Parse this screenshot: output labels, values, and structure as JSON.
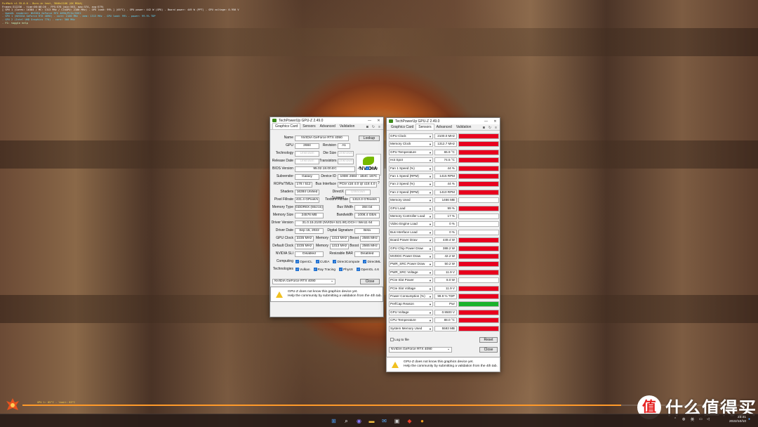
{
  "osd": {
    "line1": "FurMark v1.35.0.0 - Burn-in test, 3840x2160 (0X MSAA)",
    "line2": "Frames:312236 - time:00:08:26 - FPS:578 (min:563, max:574, avg:579)",
    "line3": "[ GPU 1 (Cores: 16384 / MC: 1313 MHz / ClkGPU: 2100 MHz) - GPU load: 99% ] (65°C) - GPU power: 442 W (GPU) - Board power: 449 W (PPT) - GPU voltage: 0.950 V",
    "line4": "- OpenGL renderer: NVIDIA GeForce RTX 4090/PCIe/SSE2",
    "line5": "- GPU 1 (NVIDIA GeForce RTX 4090) - core: 2100 MHz - mem: 1313 MHz - GPU load: 99% - power: 99.9% TDP",
    "line6": "- GPU 2 (Intel UHD Graphics 770) - core: 300 MHz",
    "line7": "- F1: toggle help",
    "bottom": "GPU 1: 65°C - limit: 83°C"
  },
  "benchmark": {
    "progress": 0.82,
    "accent": "#ff9a2a"
  },
  "window1": {
    "title": "TechPowerUp GPU-Z 2.49.0",
    "tabs": [
      "Graphics Card",
      "Sensors",
      "Advanced",
      "Validation"
    ],
    "selected_tab": "Graphics Card",
    "icons": [
      "camera-icon",
      "refresh-icon",
      "menu-icon"
    ],
    "fields": {
      "name_label": "Name",
      "name": "NVIDIA GeForce RTX 4090",
      "lookup": "Lookup",
      "gpu_label": "GPU",
      "gpu": "2684",
      "revision_label": "Revision",
      "revision": "A1",
      "technology_label": "Technology",
      "technology": "Unknown",
      "die_size_label": "Die Size",
      "die_size": "Unknown",
      "release_date_label": "Release Date",
      "release_date": "Unknown",
      "transistors_label": "Transistors",
      "transistors": "Unknown",
      "bios_label": "BIOS Version",
      "bios": "95.02.18.00.EC",
      "uefi": "UEFI",
      "subvendor_label": "Subvendor",
      "subvendor": "Galaxy",
      "device_id_label": "Device ID",
      "device_id": "10DE 2684 - 1B4C 167C",
      "rops_label": "ROPs/TMUs",
      "rops": "176 / 512",
      "bus_interface_label": "Bus Interface",
      "bus_interface": "PCIe x16 4.0 @ x16 4.0",
      "shaders_label": "Shaders",
      "shaders": "16384 Unified",
      "directx_label": "DirectX Support",
      "directx": "Unknown",
      "pixel_label": "Pixel Fillrate",
      "pixel": "431.4 GPixel/s",
      "texture_label": "Texture Fillrate",
      "texture": "1313.3 GTexel/s",
      "memtype_label": "Memory Type",
      "memtype": "GDDR6X (Micron)",
      "buswidth_label": "Bus Width",
      "buswidth": "384 bit",
      "memsize_label": "Memory Size",
      "memsize": "24576 MB",
      "bandwidth_label": "Bandwidth",
      "bandwidth": "1008.4 GB/s",
      "driver_label": "Driver Version",
      "driver": "31.0.15.2100 (NVIDIA 521.90) DCH / Win11 64",
      "driverdate_label": "Driver Date",
      "driverdate": "Sep 15, 2022",
      "digsig_label": "Digital Signature",
      "digsig": "Beta",
      "gpuclock_label": "GPU Clock",
      "gpuclock": "2235 MHz",
      "mem_label": "Memory",
      "memclock": "1313 MHz",
      "boost_label": "Boost",
      "boost": "2565 MHz",
      "defclock_label": "Default Clock",
      "defclock": "2235 MHz",
      "defmem": "1313 MHz",
      "defboost": "2565 MHz",
      "sli_label": "NVIDIA SLI",
      "sli": "Disabled",
      "rebar_label": "Resizable BAR",
      "rebar": "Disabled",
      "computing_label": "Computing",
      "technologies_label": "Technologies"
    },
    "computing": [
      {
        "label": "OpenCL",
        "checked": true
      },
      {
        "label": "CUDA",
        "checked": true
      },
      {
        "label": "DirectCompute",
        "checked": true
      },
      {
        "label": "DirectML",
        "checked": true
      }
    ],
    "technologies": [
      {
        "label": "Vulkan",
        "checked": true
      },
      {
        "label": "Ray Tracing",
        "checked": true
      },
      {
        "label": "PhysX",
        "checked": true
      },
      {
        "label": "OpenGL 4.6",
        "checked": true
      }
    ],
    "device_select": "NVIDIA GeForce RTX 4090",
    "close": "Close",
    "warning_line1": "GPU-Z does not know this graphics device yet.",
    "warning_line2": "Help the community by submitting a validation from the 4th tab."
  },
  "window2": {
    "title": "TechPowerUp GPU-Z 2.49.0",
    "tabs": [
      "Graphics Card",
      "Sensors",
      "Advanced",
      "Validation"
    ],
    "selected_tab": "Sensors",
    "sensors": [
      {
        "label": "GPU Clock",
        "value": "2100.0 MHz",
        "level": 1.0,
        "color": "#e8001e"
      },
      {
        "label": "Memory Clock",
        "value": "1312.7 MHz",
        "level": 1.0,
        "color": "#e8001e"
      },
      {
        "label": "GPU Temperature",
        "value": "65.9 °C",
        "level": 1.0,
        "color": "#e8001e"
      },
      {
        "label": "Hot Spot",
        "value": "74.5 °C",
        "level": 1.0,
        "color": "#e8001e"
      },
      {
        "label": "Fan 1 Speed (%)",
        "value": "44 %",
        "level": 1.0,
        "color": "#e8001e"
      },
      {
        "label": "Fan 1 Speed (RPM)",
        "value": "1415 RPM",
        "level": 1.0,
        "color": "#e8001e"
      },
      {
        "label": "Fan 2 Speed (%)",
        "value": "44 %",
        "level": 1.0,
        "color": "#e8001e"
      },
      {
        "label": "Fan 2 Speed (RPM)",
        "value": "1410 RPM",
        "level": 1.0,
        "color": "#e8001e"
      },
      {
        "label": "Memory Used",
        "value": "1466 MB",
        "level": 0.0,
        "color": "#e8001e"
      },
      {
        "label": "GPU Load",
        "value": "99 %",
        "level": 1.0,
        "color": "#e8001e"
      },
      {
        "label": "Memory Controller Load",
        "value": "17 %",
        "level": 0.0,
        "color": "#e8001e"
      },
      {
        "label": "Video Engine Load",
        "value": "0 %",
        "level": 0.0,
        "color": "#e8001e"
      },
      {
        "label": "Bus Interface Load",
        "value": "0 %",
        "level": 0.0,
        "color": "#e8001e"
      },
      {
        "label": "Board Power Draw",
        "value": "449.4 W",
        "level": 1.0,
        "color": "#e8001e"
      },
      {
        "label": "GPU Chip Power Draw",
        "value": "388.2 W",
        "level": 1.0,
        "color": "#e8001e"
      },
      {
        "label": "MVDDC Power Draw",
        "value": "42.2 W",
        "level": 1.0,
        "color": "#e8001e"
      },
      {
        "label": "PWR_SRC Power Draw",
        "value": "50.2 W",
        "level": 1.0,
        "color": "#e8001e"
      },
      {
        "label": "PWR_SRC Voltage",
        "value": "11.9 V",
        "level": 1.0,
        "color": "#e8001e"
      },
      {
        "label": "PCIe Slot Power",
        "value": "8.0 W",
        "level": 0.0,
        "color": "#e8001e"
      },
      {
        "label": "PCIe Slot Voltage",
        "value": "11.9 V",
        "level": 1.0,
        "color": "#e8001e"
      },
      {
        "label": "Power Consumption (%)",
        "value": "99.9 % TDP",
        "level": 1.0,
        "color": "#e8001e"
      },
      {
        "label": "PerfCap Reason",
        "value": "Pwr",
        "level": 1.0,
        "color": "#19b22b"
      },
      {
        "label": "GPU Voltage",
        "value": "0.9500 V",
        "level": 1.0,
        "color": "#e8001e"
      },
      {
        "label": "CPU Temperature",
        "value": "88.0 °C",
        "level": 1.0,
        "color": "#e8001e"
      },
      {
        "label": "System Memory Used",
        "value": "5593 MB",
        "level": 1.0,
        "color": "#e8001e"
      }
    ],
    "log_to_file": "Log to file",
    "reset": "Reset",
    "device_select": "NVIDIA GeForce RTX 4090",
    "close": "Close",
    "warning_line1": "GPU-Z does not know this graphics device yet.",
    "warning_line2": "Help the community by submitting a validation from the 4th tab."
  },
  "taskbar": {
    "apps": [
      {
        "name": "start-icon",
        "glyph": "⊞",
        "color": "#4aa3ff"
      },
      {
        "name": "search-icon",
        "glyph": "⌕",
        "color": "#ffffff"
      },
      {
        "name": "chat-icon",
        "glyph": "◉",
        "color": "#8a7cff"
      },
      {
        "name": "file-explorer-icon",
        "glyph": "▬",
        "color": "#f2c040"
      },
      {
        "name": "mail-icon",
        "glyph": "✉",
        "color": "#5ab0ff"
      },
      {
        "name": "gpuz-icon",
        "glyph": "▣",
        "color": "#cfcfcf"
      },
      {
        "name": "furmark-icon",
        "glyph": "◆",
        "color": "#e9402a"
      },
      {
        "name": "app-icon",
        "glyph": "●",
        "color": "#f0a020"
      }
    ],
    "tray_lang": "英",
    "time": "23:41",
    "date": "2022/10/10"
  },
  "watermark": {
    "logo_char": "值",
    "text": "什么值得买"
  }
}
